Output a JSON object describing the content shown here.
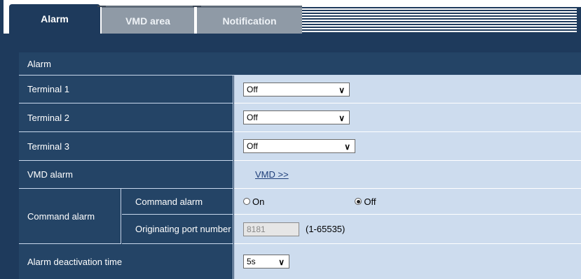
{
  "tabs": [
    {
      "label": "Alarm"
    },
    {
      "label": "VMD area"
    },
    {
      "label": "Notification"
    }
  ],
  "section": {
    "title": "Alarm"
  },
  "rows": {
    "terminal1": {
      "label": "Terminal 1",
      "value": "Off"
    },
    "terminal2": {
      "label": "Terminal 2",
      "value": "Off"
    },
    "terminal3": {
      "label": "Terminal 3",
      "value": "Off"
    },
    "vmd_alarm": {
      "label": "VMD alarm",
      "link": "VMD >>"
    },
    "command_alarm": {
      "label": "Command alarm",
      "sub_command": {
        "label": "Command alarm",
        "on_label": "On",
        "off_label": "Off",
        "selected": "Off"
      },
      "sub_port": {
        "label": "Originating port number",
        "value": "8181",
        "range": "(1-65535)"
      }
    },
    "deactivation": {
      "label": "Alarm deactivation time",
      "value": "5s"
    }
  },
  "colors": {
    "header": "#244466",
    "value_bg": "#cddcee",
    "frame": "#1e3a5c"
  }
}
